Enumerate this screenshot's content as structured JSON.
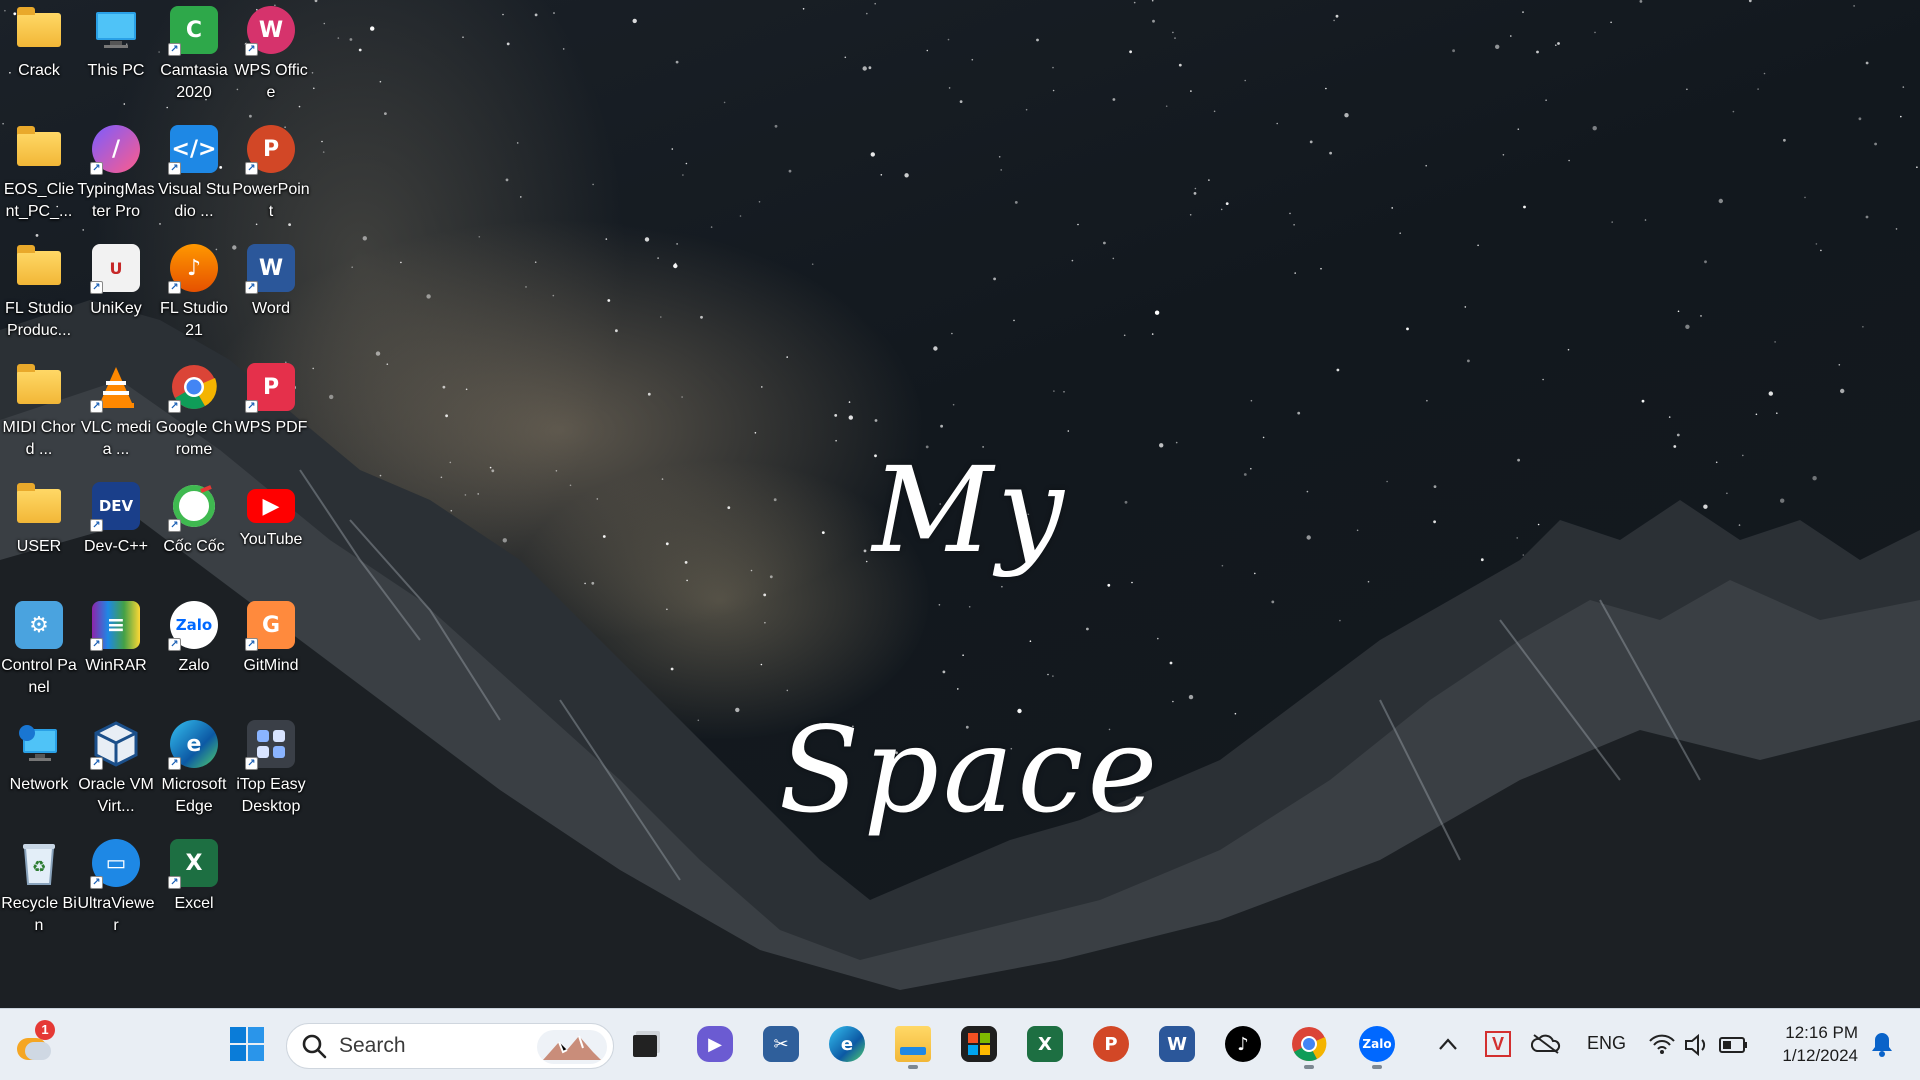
{
  "wallpaper": {
    "slogan": "My Space"
  },
  "desktop_icons": [
    {
      "label": "Crack",
      "icon": "folder-icon"
    },
    {
      "label": "This PC",
      "icon": "computer-icon"
    },
    {
      "label": "Camtasia 2020",
      "icon": "camtasia-icon"
    },
    {
      "label": "WPS Office",
      "icon": "wps-office-icon"
    },
    {
      "label": "EOS_Client_PC_...",
      "icon": "folder-icon"
    },
    {
      "label": "TypingMaster Pro",
      "icon": "typingmaster-icon"
    },
    {
      "label": "Visual Studio ...",
      "icon": "vscode-icon"
    },
    {
      "label": "PowerPoint",
      "icon": "powerpoint-icon"
    },
    {
      "label": "FL Studio Produc...",
      "icon": "folder-icon"
    },
    {
      "label": "UniKey",
      "icon": "unikey-icon"
    },
    {
      "label": "FL Studio 21",
      "icon": "fl-studio-icon"
    },
    {
      "label": "Word",
      "icon": "word-icon"
    },
    {
      "label": "MIDI Chord ...",
      "icon": "folder-icon"
    },
    {
      "label": "VLC media ...",
      "icon": "vlc-icon"
    },
    {
      "label": "Google Chrome",
      "icon": "chrome-icon"
    },
    {
      "label": "WPS PDF",
      "icon": "wps-pdf-icon"
    },
    {
      "label": "USER",
      "icon": "folder-icon"
    },
    {
      "label": "Dev-C++",
      "icon": "devcpp-icon"
    },
    {
      "label": "Cốc Cốc",
      "icon": "coccoc-icon"
    },
    {
      "label": "YouTube",
      "icon": "youtube-icon"
    },
    {
      "label": "Control Panel",
      "icon": "control-panel-icon"
    },
    {
      "label": "WinRAR",
      "icon": "winrar-icon"
    },
    {
      "label": "Zalo",
      "icon": "zalo-icon"
    },
    {
      "label": "GitMind",
      "icon": "gitmind-icon"
    },
    {
      "label": "Network",
      "icon": "network-icon"
    },
    {
      "label": "Oracle VM Virt...",
      "icon": "virtualbox-icon"
    },
    {
      "label": "Microsoft Edge",
      "icon": "edge-icon"
    },
    {
      "label": "iTop Easy Desktop",
      "icon": "itop-icon"
    },
    {
      "label": "Recycle Bin",
      "icon": "recycle-bin-icon"
    },
    {
      "label": "UltraViewer",
      "icon": "ultraviewer-icon"
    },
    {
      "label": "Excel",
      "icon": "excel-icon"
    }
  ],
  "taskbar": {
    "weather_badge": "1",
    "search_placeholder": "Search",
    "apps": [
      {
        "name": "task-view",
        "icon": "task-view-icon"
      },
      {
        "name": "teams-chat",
        "icon": "chat-icon"
      },
      {
        "name": "snipping-tool",
        "icon": "snipping-tool-icon"
      },
      {
        "name": "edge",
        "icon": "edge-icon"
      },
      {
        "name": "file-explorer",
        "icon": "file-explorer-icon"
      },
      {
        "name": "microsoft-store",
        "icon": "store-icon"
      },
      {
        "name": "excel",
        "icon": "excel-icon"
      },
      {
        "name": "powerpoint",
        "icon": "powerpoint-icon"
      },
      {
        "name": "word",
        "icon": "word-icon"
      },
      {
        "name": "tiktok",
        "icon": "tiktok-icon"
      },
      {
        "name": "chrome",
        "icon": "chrome-icon"
      },
      {
        "name": "zalo",
        "icon": "zalo-icon"
      }
    ],
    "zalo_text": "Zalo",
    "tray": {
      "language": "ENG",
      "time": "12:16 PM",
      "date": "1/12/2024"
    }
  }
}
